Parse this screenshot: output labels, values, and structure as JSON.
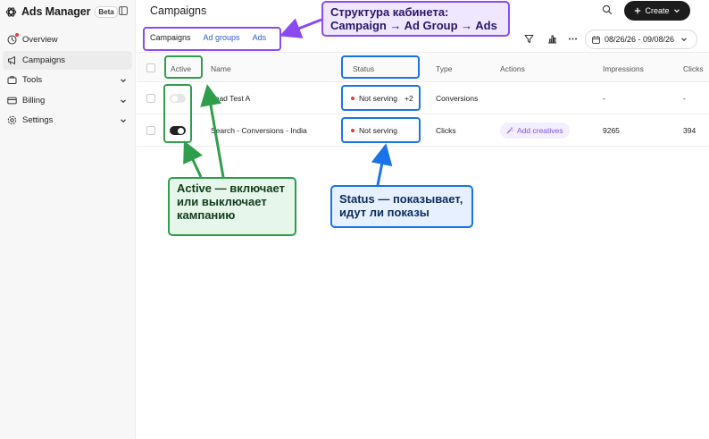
{
  "app": {
    "name": "Ads Manager",
    "badge": "Beta"
  },
  "sidebar": {
    "items": [
      {
        "label": "Overview",
        "icon": "overview-icon",
        "has_notification": true
      },
      {
        "label": "Campaigns",
        "icon": "megaphone-icon",
        "active": true
      },
      {
        "label": "Tools",
        "icon": "tools-icon",
        "expandable": true
      },
      {
        "label": "Billing",
        "icon": "billing-icon",
        "expandable": true
      },
      {
        "label": "Settings",
        "icon": "gear-icon",
        "expandable": true
      }
    ]
  },
  "header": {
    "title": "Campaigns",
    "create_label": "Create"
  },
  "tabs": [
    {
      "label": "Campaigns",
      "selected": true
    },
    {
      "label": "Ad groups"
    },
    {
      "label": "Ads"
    }
  ],
  "toolbar": {
    "date_range": "08/26/26 - 09/08/26"
  },
  "table": {
    "headers": {
      "active": "Active",
      "name": "Name",
      "status": "Status",
      "type": "Type",
      "actions": "Actions",
      "impressions": "Impressions",
      "clicks": "Clicks"
    },
    "rows": [
      {
        "active": false,
        "name": "Lead Test A",
        "status": "Not serving",
        "status_extra": "+2",
        "type": "Conversions",
        "action": "",
        "impressions": "-",
        "clicks": "-"
      },
      {
        "active": true,
        "name": "Search - Conversions - India",
        "status": "Not serving",
        "status_extra": "",
        "type": "Clicks",
        "action": "Add creatives",
        "impressions": "9265",
        "clicks": "394"
      }
    ]
  },
  "annotations": {
    "structure": {
      "line1": "Структура кабинета:",
      "line2": "Campaign → Ad Group → Ads",
      "color": "#8a4bf2"
    },
    "active": {
      "line1": "Active — включает",
      "line2": "или выключает",
      "line3": "кампанию",
      "color": "#2f9e4c"
    },
    "status": {
      "line1": "Status — показывает,",
      "line2": "идут ли показы",
      "color": "#1a73e8"
    }
  }
}
